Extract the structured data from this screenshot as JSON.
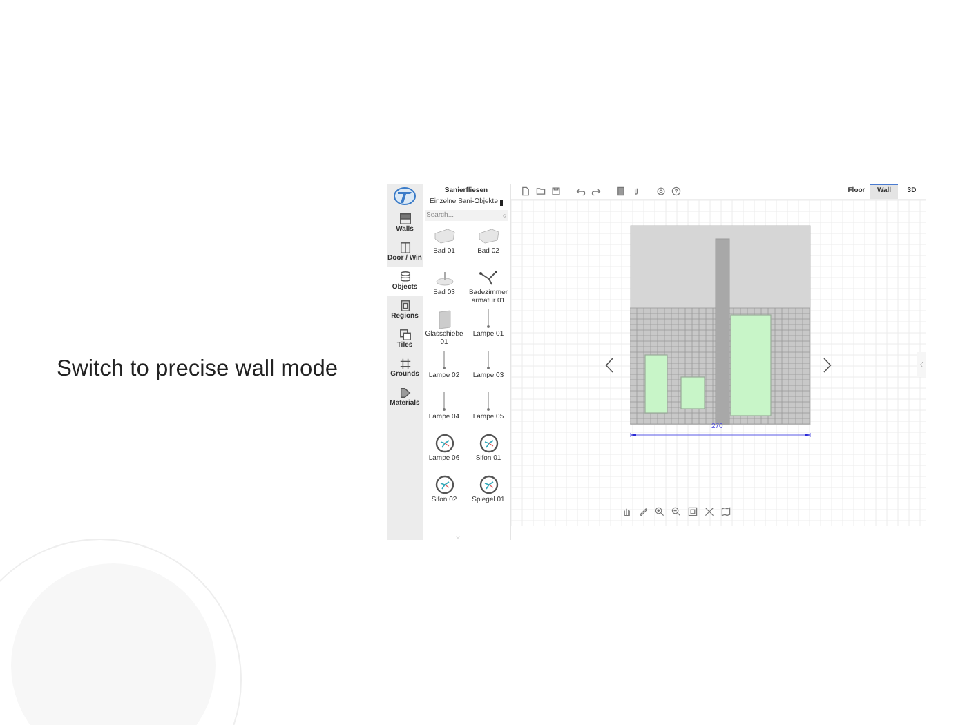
{
  "caption": "Switch to precise wall mode",
  "rail": [
    {
      "label": "Walls",
      "kind": "walls",
      "selected": false
    },
    {
      "label": "Door / Win",
      "kind": "door",
      "selected": false
    },
    {
      "label": "Objects",
      "kind": "objects",
      "selected": true
    },
    {
      "label": "Regions",
      "kind": "regions",
      "selected": false
    },
    {
      "label": "Tiles",
      "kind": "tiles",
      "selected": false
    },
    {
      "label": "Grounds",
      "kind": "grounds",
      "selected": false
    },
    {
      "label": "Materials",
      "kind": "materials",
      "selected": false
    }
  ],
  "panel": {
    "title": "Sanierfliesen",
    "dropdown": "Einzelne Sani-Objekte",
    "search": {
      "placeholder": "Search..."
    },
    "items": [
      {
        "label": "Bad 01",
        "kind": "tub"
      },
      {
        "label": "Bad 02",
        "kind": "tub"
      },
      {
        "label": "Bad 03",
        "kind": "basin"
      },
      {
        "label": "Badezimmerarmatur 01",
        "kind": "faucet"
      },
      {
        "label": "Glasschiebe 01",
        "kind": "panel"
      },
      {
        "label": "Lampe 01",
        "kind": "lamp"
      },
      {
        "label": "Lampe 02",
        "kind": "lamp"
      },
      {
        "label": "Lampe 03",
        "kind": "lamp"
      },
      {
        "label": "Lampe 04",
        "kind": "lamp"
      },
      {
        "label": "Lampe 05",
        "kind": "lamp"
      },
      {
        "label": "Lampe 06",
        "kind": "dial"
      },
      {
        "label": "Sifon 01",
        "kind": "dial"
      },
      {
        "label": "Sifon 02",
        "kind": "dial"
      },
      {
        "label": "Spiegel 01",
        "kind": "dial"
      }
    ]
  },
  "view_tabs": [
    {
      "label": "Floor",
      "selected": false
    },
    {
      "label": "Wall",
      "selected": true
    },
    {
      "label": "3D",
      "selected": false
    }
  ],
  "dimension": "270"
}
